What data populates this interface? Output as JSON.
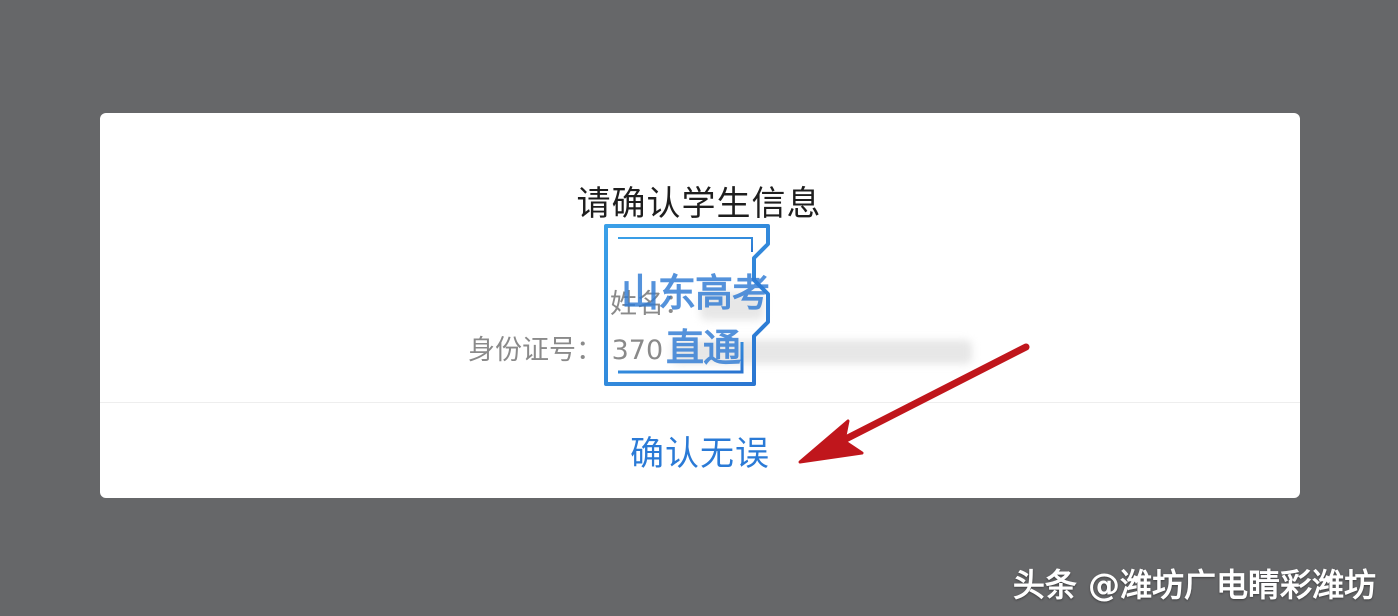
{
  "dialog": {
    "title": "请确认学生信息",
    "name_label": "姓名：",
    "id_label": "身份证号：",
    "id_value_visible": "370",
    "confirm_label": "确认无误"
  },
  "logo": {
    "line1": "山东高考",
    "line2": "直通"
  },
  "watermark": {
    "text": "头条 @潍坊广电睛彩潍坊"
  },
  "colors": {
    "backdrop": "#666769",
    "confirm_text": "#2a7ad6",
    "arrow": "#c0161c",
    "logo": "#2e7ad3"
  }
}
